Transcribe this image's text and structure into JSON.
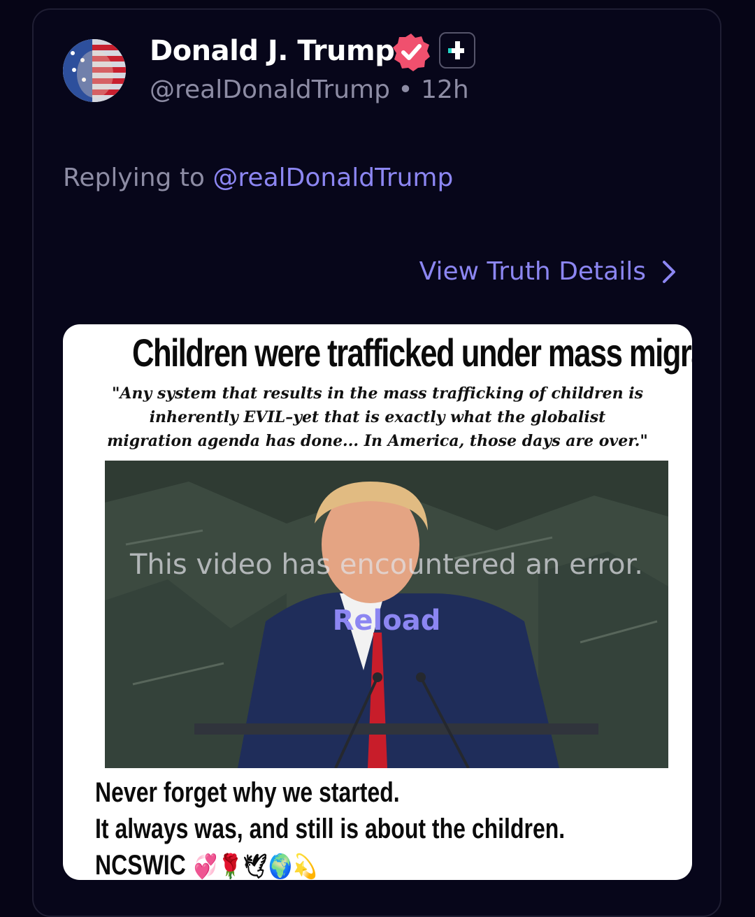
{
  "post": {
    "author_name": "Donald J. Trump",
    "handle": "@realDonaldTrump",
    "separator": "•",
    "time": "12h",
    "reply_prefix": "Replying to",
    "reply_mention": "@realDonaldTrump",
    "details_link": "View Truth Details"
  },
  "media": {
    "headline": "Children were trafficked under mass migration",
    "quote": "\"Any system that results in the mass trafficking of children is inherently EVIL–yet that is exactly what the globalist migration agenda has done... In America, those days are over.\"",
    "video_error": "This video has encountered an error.",
    "reload_label": "Reload",
    "caption_lines": [
      "Never forget why we started.",
      "It always was, and still is about the children.",
      "NCSWIC"
    ],
    "caption_emojis": "💞🌹🕊🌍💫"
  },
  "colors": {
    "background": "#060516",
    "accent": "#8c86f2",
    "verified": "#f0506e",
    "muted_text": "#8d8ca4"
  },
  "icons": [
    "avatar",
    "verified-badge-icon",
    "plus-icon",
    "chevron-right-icon"
  ]
}
